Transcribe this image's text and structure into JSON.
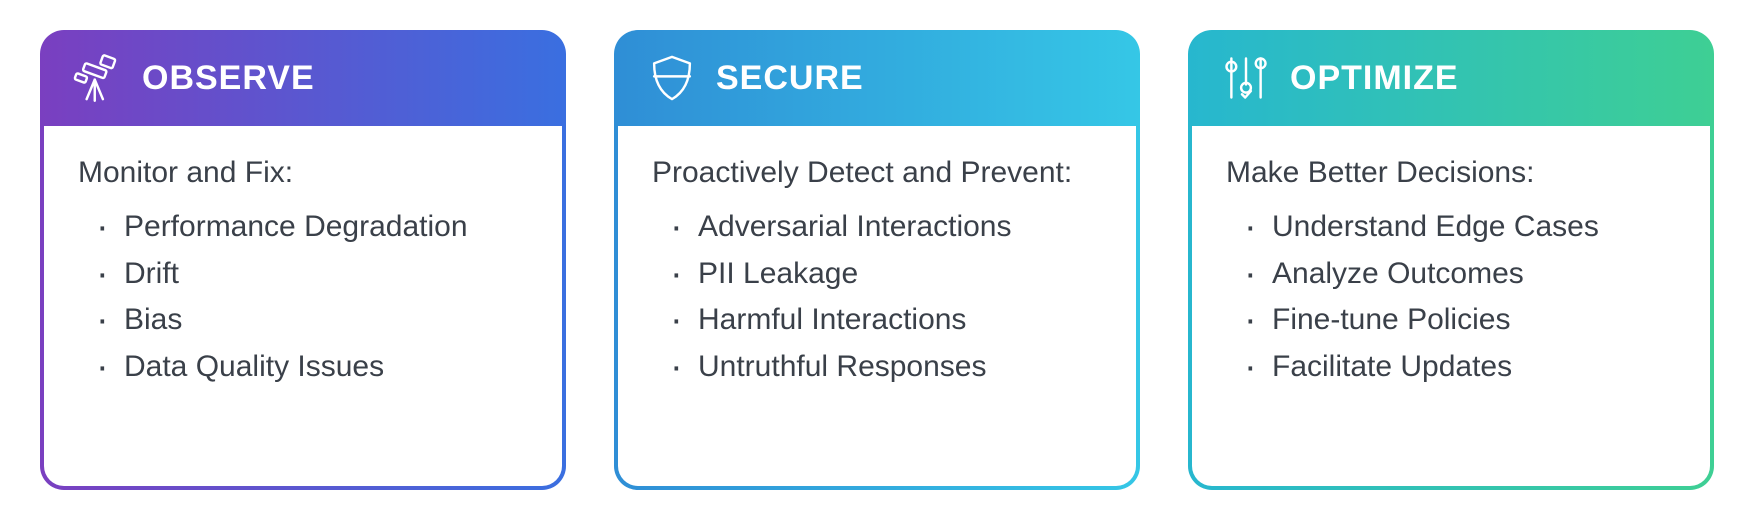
{
  "cards": [
    {
      "id": "observe",
      "title": "OBSERVE",
      "icon": "telescope-icon",
      "gradient_class": "g-observe",
      "lead": "Monitor and Fix:",
      "items": [
        "Performance Degradation",
        "Drift",
        "Bias",
        "Data Quality Issues"
      ]
    },
    {
      "id": "secure",
      "title": "SECURE",
      "icon": "shield-icon",
      "gradient_class": "g-secure",
      "lead": "Proactively Detect and Prevent:",
      "items": [
        "Adversarial Interactions",
        "PII Leakage",
        "Harmful Interactions",
        "Untruthful Responses"
      ]
    },
    {
      "id": "optimize",
      "title": "OPTIMIZE",
      "icon": "sliders-icon",
      "gradient_class": "g-optimize",
      "lead": "Make Better Decisions:",
      "items": [
        "Understand Edge Cases",
        "Analyze Outcomes",
        "Fine-tune Policies",
        "Facilitate Updates"
      ]
    }
  ],
  "colors": {
    "observe_from": "#7a3fc0",
    "observe_to": "#3a6fe0",
    "secure_from": "#2f8ed6",
    "secure_to": "#35c7e6",
    "optimize_from": "#27b7cf",
    "optimize_to": "#3ecf94",
    "text": "#3a4049"
  }
}
